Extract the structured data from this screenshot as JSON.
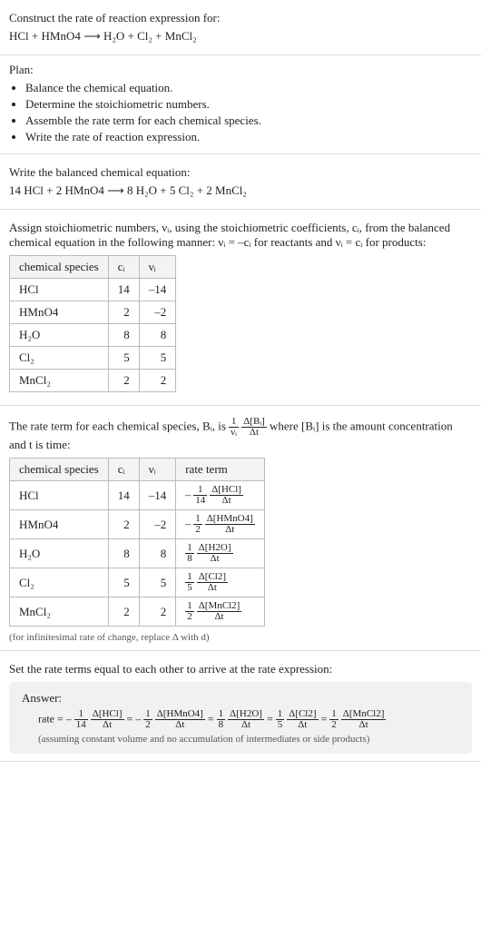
{
  "intro": {
    "title": "Construct the rate of reaction expression for:",
    "equation": "HCl + HMnO4  ⟶  H₂O + Cl₂ + MnCl₂"
  },
  "plan": {
    "label": "Plan:",
    "items": [
      "Balance the chemical equation.",
      "Determine the stoichiometric numbers.",
      "Assemble the rate term for each chemical species.",
      "Write the rate of reaction expression."
    ]
  },
  "balanced": {
    "label": "Write the balanced chemical equation:",
    "equation": "14 HCl + 2 HMnO4  ⟶  8 H₂O + 5 Cl₂ + 2 MnCl₂"
  },
  "stoich": {
    "intro": "Assign stoichiometric numbers, νᵢ, using the stoichiometric coefficients, cᵢ, from the balanced chemical equation in the following manner: νᵢ = –cᵢ for reactants and νᵢ = cᵢ for products:",
    "headers": [
      "chemical species",
      "cᵢ",
      "νᵢ"
    ],
    "rows": [
      {
        "species": "HCl",
        "c": "14",
        "v": "–14"
      },
      {
        "species": "HMnO4",
        "c": "2",
        "v": "–2"
      },
      {
        "species": "H₂O",
        "c": "8",
        "v": "8"
      },
      {
        "species": "Cl₂",
        "c": "5",
        "v": "5"
      },
      {
        "species": "MnCl₂",
        "c": "2",
        "v": "2"
      }
    ]
  },
  "rateterm": {
    "intro_a": "The rate term for each chemical species, Bᵢ, is ",
    "intro_b": " where [Bᵢ] is the amount concentration and t is time:",
    "headers": [
      "chemical species",
      "cᵢ",
      "νᵢ",
      "rate term"
    ],
    "rows": [
      {
        "species": "HCl",
        "c": "14",
        "v": "–14",
        "sign": "–",
        "coef_n": "1",
        "coef_d": "14",
        "conc": "Δ[HCl]"
      },
      {
        "species": "HMnO4",
        "c": "2",
        "v": "–2",
        "sign": "–",
        "coef_n": "1",
        "coef_d": "2",
        "conc": "Δ[HMnO4]"
      },
      {
        "species": "H₂O",
        "c": "8",
        "v": "8",
        "sign": "",
        "coef_n": "1",
        "coef_d": "8",
        "conc": "Δ[H2O]"
      },
      {
        "species": "Cl₂",
        "c": "5",
        "v": "5",
        "sign": "",
        "coef_n": "1",
        "coef_d": "5",
        "conc": "Δ[Cl2]"
      },
      {
        "species": "MnCl₂",
        "c": "2",
        "v": "2",
        "sign": "",
        "coef_n": "1",
        "coef_d": "2",
        "conc": "Δ[MnCl2]"
      }
    ],
    "note": "(for infinitesimal rate of change, replace Δ with d)"
  },
  "final": {
    "label": "Set the rate terms equal to each other to arrive at the rate expression:",
    "answer_label": "Answer:",
    "terms": [
      {
        "sign": "–",
        "n": "1",
        "d": "14",
        "conc": "Δ[HCl]"
      },
      {
        "sign": "–",
        "n": "1",
        "d": "2",
        "conc": "Δ[HMnO4]"
      },
      {
        "sign": "",
        "n": "1",
        "d": "8",
        "conc": "Δ[H2O]"
      },
      {
        "sign": "",
        "n": "1",
        "d": "5",
        "conc": "Δ[Cl2]"
      },
      {
        "sign": "",
        "n": "1",
        "d": "2",
        "conc": "Δ[MnCl2]"
      }
    ],
    "note": "(assuming constant volume and no accumulation of intermediates or side products)"
  },
  "chart_data": {
    "type": "table",
    "tables": [
      {
        "title": "Stoichiometric numbers",
        "columns": [
          "chemical species",
          "cᵢ",
          "νᵢ"
        ],
        "rows": [
          [
            "HCl",
            14,
            -14
          ],
          [
            "HMnO4",
            2,
            -2
          ],
          [
            "H₂O",
            8,
            8
          ],
          [
            "Cl₂",
            5,
            5
          ],
          [
            "MnCl₂",
            2,
            2
          ]
        ]
      },
      {
        "title": "Rate terms",
        "columns": [
          "chemical species",
          "cᵢ",
          "νᵢ",
          "rate term"
        ],
        "rows": [
          [
            "HCl",
            14,
            -14,
            "-(1/14) Δ[HCl]/Δt"
          ],
          [
            "HMnO4",
            2,
            -2,
            "-(1/2) Δ[HMnO4]/Δt"
          ],
          [
            "H₂O",
            8,
            8,
            "(1/8) Δ[H2O]/Δt"
          ],
          [
            "Cl₂",
            5,
            5,
            "(1/5) Δ[Cl2]/Δt"
          ],
          [
            "MnCl₂",
            2,
            2,
            "(1/2) Δ[MnCl2]/Δt"
          ]
        ]
      }
    ],
    "balanced_equation": "14 HCl + 2 HMnO4 ⟶ 8 H₂O + 5 Cl₂ + 2 MnCl₂",
    "rate_expression": "rate = -(1/14)Δ[HCl]/Δt = -(1/2)Δ[HMnO4]/Δt = (1/8)Δ[H2O]/Δt = (1/5)Δ[Cl2]/Δt = (1/2)Δ[MnCl2]/Δt"
  }
}
